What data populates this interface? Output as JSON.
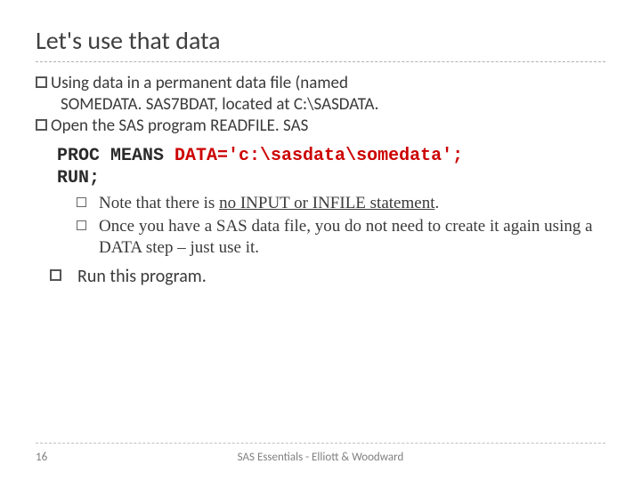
{
  "title": "Let's use that data",
  "bullets": {
    "b1_prefix": "Using",
    "b1_rest": " data in a permanent data file (named",
    "b1_line2": "SOMEDATA. SAS7BDAT, located at C:\\SASDATA.",
    "b2_prefix": "Open",
    "b2_rest": " the SAS program READFILE. SAS"
  },
  "code": {
    "line1_plain": "PROC MEANS ",
    "line1_red": "DATA='c:\\sasdata\\somedata';",
    "line2": "RUN;"
  },
  "subs": {
    "s1a": "Note that there is ",
    "s1u": "no INPUT or INFILE statement",
    "s1b": ".",
    "s2": "Once you have a SAS data file, you do not need to create it again using a DATA step – just use it."
  },
  "run": "Run this program.",
  "footer": {
    "page": "16",
    "text": "SAS Essentials - Elliott & Woodward"
  }
}
